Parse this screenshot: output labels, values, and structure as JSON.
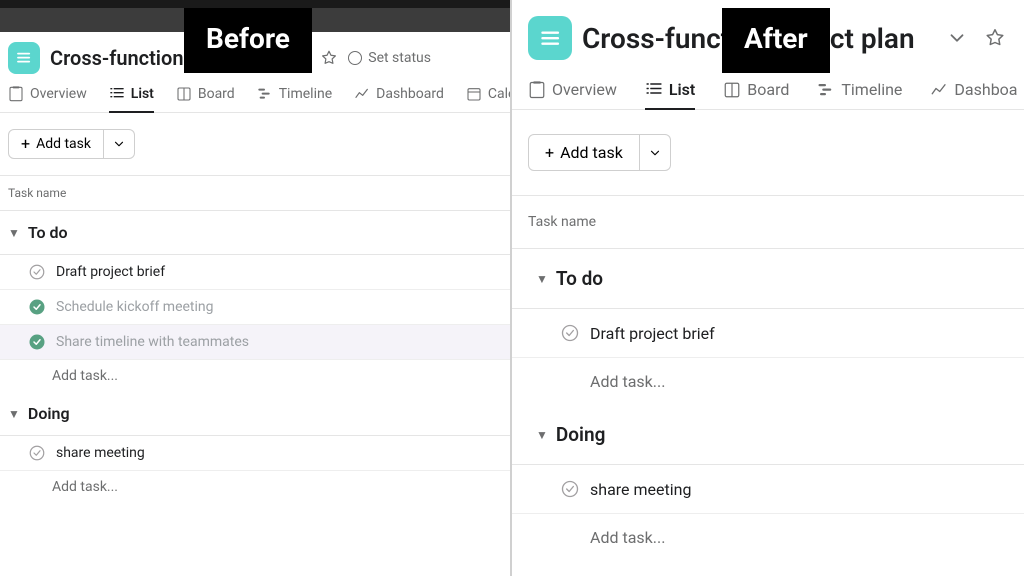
{
  "badges": {
    "before": "Before",
    "after": "After"
  },
  "project": {
    "title_left": "Cross-functional project plan",
    "title_right_a": "Cross-funct",
    "title_right_b": "ect plan",
    "set_status": "Set status"
  },
  "tabs": {
    "overview": "Overview",
    "list": "List",
    "board": "Board",
    "timeline": "Timeline",
    "dashboard": "Dashboard",
    "calendar": "Calendar",
    "dashboard_cut": "Dashboa"
  },
  "toolbar": {
    "add_task": "Add task"
  },
  "columns": {
    "task_name": "Task name"
  },
  "left": {
    "sections": [
      {
        "name": "To do",
        "tasks": [
          {
            "title": "Draft project brief",
            "done": false,
            "hover": false
          },
          {
            "title": "Schedule kickoff meeting",
            "done": true,
            "hover": false
          },
          {
            "title": "Share timeline with teammates",
            "done": true,
            "hover": true
          }
        ]
      },
      {
        "name": "Doing",
        "tasks": [
          {
            "title": "share meeting",
            "done": false,
            "hover": false
          }
        ]
      }
    ],
    "add_task_inline": "Add task..."
  },
  "right": {
    "sections": [
      {
        "name": "To do",
        "tasks": [
          {
            "title": "Draft project brief",
            "done": false
          }
        ]
      },
      {
        "name": "Doing",
        "tasks": [
          {
            "title": "share meeting",
            "done": false
          }
        ]
      }
    ],
    "add_task_inline": "Add task..."
  }
}
